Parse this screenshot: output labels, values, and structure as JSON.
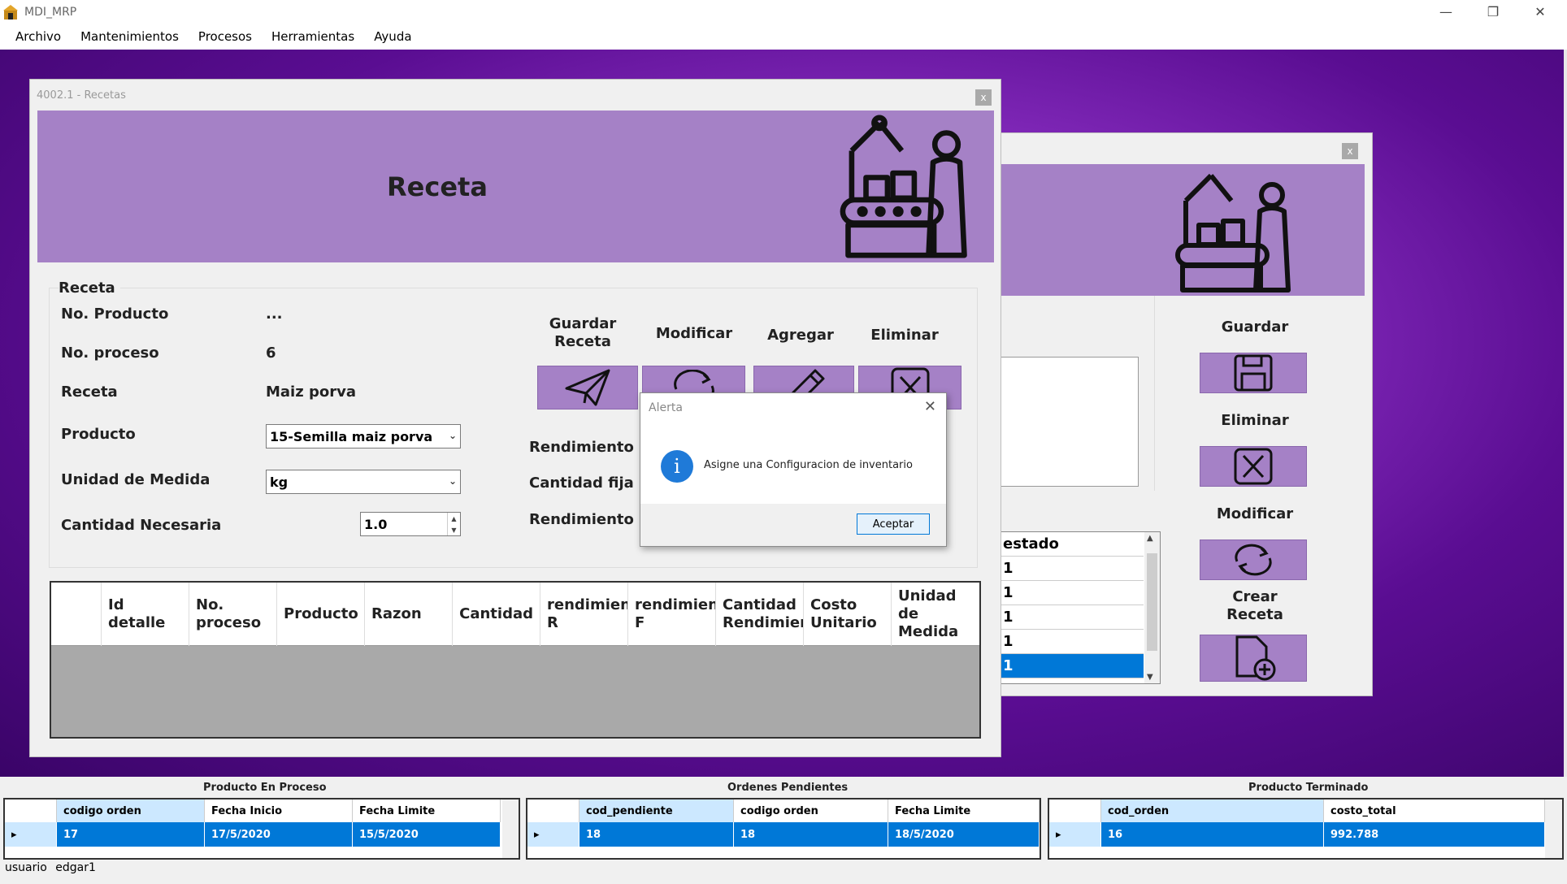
{
  "app": {
    "title": "MDI_MRP"
  },
  "menu": [
    "Archivo",
    "Mantenimientos",
    "Procesos",
    "Herramientas",
    "Ayuda"
  ],
  "receta_window": {
    "title": "4002.1 - Recetas",
    "banner_title": "Receta",
    "section_title": "Receta",
    "fields": {
      "no_producto_label": "No. Producto",
      "no_producto_value": "...",
      "no_proceso_label": "No. proceso",
      "no_proceso_value": "6",
      "receta_label": "Receta",
      "receta_value": "Maiz porva",
      "producto_label": "Producto",
      "producto_value": "15-Semilla maiz porva",
      "unidad_label": "Unidad de Medida",
      "unidad_value": "kg",
      "cantidad_label": "Cantidad Necesaria",
      "cantidad_value": "1.0"
    },
    "actions": {
      "guardar": "Guardar\nReceta",
      "modificar": "Modificar",
      "agregar": "Agregar",
      "eliminar": "Eliminar"
    },
    "rendimiento_labels": [
      "Rendimiento R",
      "Cantidad fija",
      "Rendimiento"
    ],
    "grid_columns": [
      "Id\ndetalle",
      "No.\nproceso",
      "Producto",
      "Razon",
      "Cantidad",
      "rendimiento\nR",
      "rendimiento\nF",
      "Cantidad\nRendimiento",
      "Costo\nUnitario",
      "Unidad\nde\nMedida"
    ]
  },
  "second_window": {
    "actions": {
      "guardar": "Guardar",
      "eliminar": "Eliminar",
      "modificar": "Modificar",
      "crear": "Crear\nReceta"
    },
    "list_header": "estado",
    "list_rows": [
      "1",
      "1",
      "1",
      "1",
      "1"
    ]
  },
  "dialog": {
    "title": "Alerta",
    "message": "Asigne una Configuracion de inventario",
    "button": "Aceptar"
  },
  "bottom": {
    "proceso": {
      "title": "Producto En Proceso",
      "columns": [
        "codigo orden",
        "Fecha Inicio",
        "Fecha Limite"
      ],
      "row": [
        "17",
        "17/5/2020",
        "15/5/2020"
      ]
    },
    "pendientes": {
      "title": "Ordenes Pendientes",
      "columns": [
        "cod_pendiente",
        "codigo orden",
        "Fecha Limite"
      ],
      "row": [
        "18",
        "18",
        "18/5/2020"
      ]
    },
    "terminado": {
      "title": "Producto Terminado",
      "columns": [
        "cod_orden",
        "costo_total"
      ],
      "row": [
        "16",
        "992.788"
      ]
    }
  },
  "status": {
    "user_label": "usuario",
    "user_value": "edgar1"
  },
  "colors": {
    "accent": "#a581c6",
    "selection": "#0078d7"
  }
}
